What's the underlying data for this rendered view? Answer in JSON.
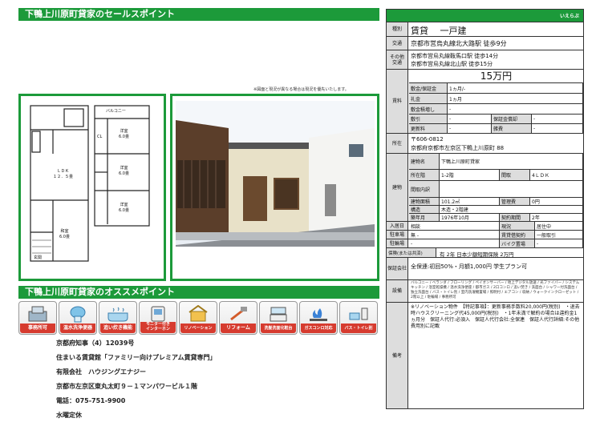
{
  "left": {
    "top_band": "下鴨上川原町貸家のセールスポイント",
    "mid_band": "下鴨上川原町貸家のオススメポイント",
    "note": "※図面と現況が異なる場合は現況を優先いたします。",
    "floorplan": {
      "balcony": "バルコニー",
      "room1": "洋室\n6.0畳",
      "room2": "洋室\n6.0畳",
      "room3": "洋室\n6.0畳",
      "ldk": "ＬＤＫ\n１２．５畳",
      "washitsu": "和室\n6.0畳",
      "cl": "CL",
      "genkan": "玄関"
    }
  },
  "icons": [
    {
      "name": "office-icon",
      "label": "事務所可"
    },
    {
      "name": "toilet-seat-icon",
      "label": "温水洗浄便器"
    },
    {
      "name": "bath-reheat-icon",
      "label": "追い炊き機能"
    },
    {
      "name": "intercom-icon",
      "label": "モニター付き\nインターホン"
    },
    {
      "name": "renovation-icon",
      "label": "リノベーション"
    },
    {
      "name": "reform-icon",
      "label": "リフォーム"
    },
    {
      "name": "washbasin-icon",
      "label": "洗髪洗面化粧台"
    },
    {
      "name": "gas-stove-icon",
      "label": "ガスコンロ対応"
    },
    {
      "name": "separate-bath-icon",
      "label": "バス・トイレ別"
    }
  ],
  "company": {
    "license": "京都府知事（4）12039号",
    "member": "住まいる賃貸館「ファミリー向けプレミアム賃貸専門」",
    "name": "有限会社　ハウジングエナジー",
    "address": "京都市左京区東丸太町９－１マンパワービル１階",
    "tel": "電話：075-751-9900",
    "holiday": "水曜定休"
  },
  "panel": {
    "logo": "いえらぶ",
    "type_label": "種別",
    "type_value": "賃貸　 一戸建",
    "transit_label": "交通",
    "transit_value": "京都市営烏丸線北大路駅 徒歩9分",
    "other_transit_label": "その他\n交通",
    "other_transit_1": "京都市営烏丸線鞍馬口駅 徒歩14分",
    "other_transit_2": "京都市営烏丸線北山駅 徒歩15分",
    "price": "15万円",
    "fees_label": "賃料",
    "fees": [
      [
        "敷金/保証金",
        "1ヵ月/-",
        "",
        ""
      ],
      [
        "礼金",
        "1ヵ月",
        "",
        ""
      ],
      [
        "敷金積増し",
        "-",
        "",
        ""
      ],
      [
        "敷引",
        "-",
        "保証金償却",
        "-"
      ],
      [
        "更新料",
        "-",
        "雑費",
        "-"
      ]
    ],
    "location_label": "所在",
    "postal": "〒606-0812",
    "address": "京都府京都市左京区下鴨上川原町 88",
    "building_label": "建物",
    "building_name_label": "建物名",
    "building_name": "下鴨上川原町貸家",
    "floor_label": "所在階",
    "floor": "1-2階",
    "layout_label": "間取",
    "layout": "4ＬＤＫ",
    "layout_detail_label": "間取内訳",
    "layout_detail": "",
    "area_label": "建物面積",
    "area": "101.2㎡",
    "mgmt_label": "管理費",
    "mgmt": "0円",
    "structure_label": "構造",
    "structure": "木造・2階建",
    "built_label": "築年月",
    "built": "1976年10月",
    "contract_label": "契約期間",
    "contract": "2年",
    "move_label": "入居日",
    "move": "相談",
    "status_label": "現況",
    "status": "居住中",
    "parking_label": "駐車場",
    "parking": "無 -",
    "deal_label": "賃貸借契約",
    "deal": "一般取引",
    "bike_label": "駐輪場",
    "bike": "-",
    "bike2_label": "バイク置場",
    "bike2": "-",
    "insurance_label": "保険(または共済)",
    "insurance": "有 2年 日本少額短期保険 2万円",
    "renewal_label": "保証会社",
    "renewal": "全保連:初回50%・月額1,000円 学生プラン可",
    "equip_label": "設備",
    "equip_text": "バルコニー / ベランダ / フローリング / ペイオンサーバー / 地上デジタル放送 / 光ファイバー / システムキッチン / 浴室乾燥機 / 温水洗浄便座 / 都市ガス / 2口コンロ / 追い焚き / 洗面台 / シャワー付洗面台 / 独立洗面台 / バス・トイレ別 / 室内洗濯機置場 / 照明付 / エアコン / 収納 / ウォークインクローゼット / 2階以上 / 駐輪場 / 事務所可",
    "remarks_label": "備考",
    "remarks": "※リノベーション物件　【特記事項】：更新事務手数料20,000円(税別)　・退去時ハウスクリーニング代45,000円(税別)　・1年未満で解約の場合は違約金1ヵ月分　保証人代行:必須入　保証人代行会社:全保連　保証人代行詳細:その他費用別に記載"
  }
}
